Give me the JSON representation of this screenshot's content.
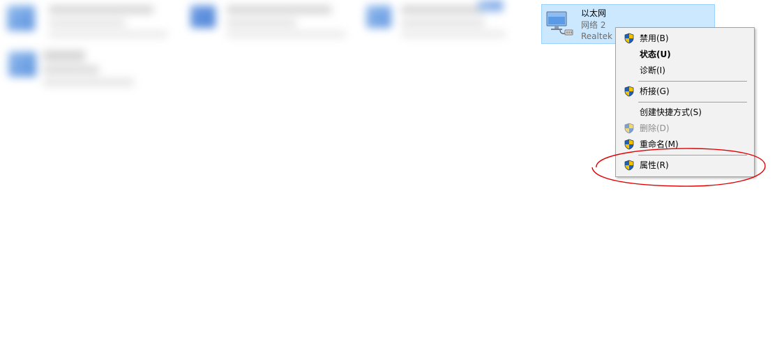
{
  "adapter": {
    "name": "以太网",
    "network": "网络 2",
    "device": "Realtek I",
    "icon": "network-adapter-icon"
  },
  "context_menu": {
    "items": [
      {
        "label": "禁用(B)",
        "shield": true,
        "bold": false,
        "disabled": false
      },
      {
        "label": "状态(U)",
        "shield": false,
        "bold": true,
        "disabled": false
      },
      {
        "label": "诊断(I)",
        "shield": false,
        "bold": false,
        "disabled": false
      },
      {
        "label": "桥接(G)",
        "shield": true,
        "bold": false,
        "disabled": false
      },
      {
        "label": "创建快捷方式(S)",
        "shield": false,
        "bold": false,
        "disabled": false
      },
      {
        "label": "删除(D)",
        "shield": true,
        "bold": false,
        "disabled": true
      },
      {
        "label": "重命名(M)",
        "shield": true,
        "bold": false,
        "disabled": false
      },
      {
        "label": "属性(R)",
        "shield": true,
        "bold": false,
        "disabled": false
      }
    ]
  },
  "colors": {
    "selection_bg": "#cce8ff",
    "selection_border": "#99d1ff",
    "menu_bg": "#f2f2f2",
    "annotation": "#e00000"
  }
}
